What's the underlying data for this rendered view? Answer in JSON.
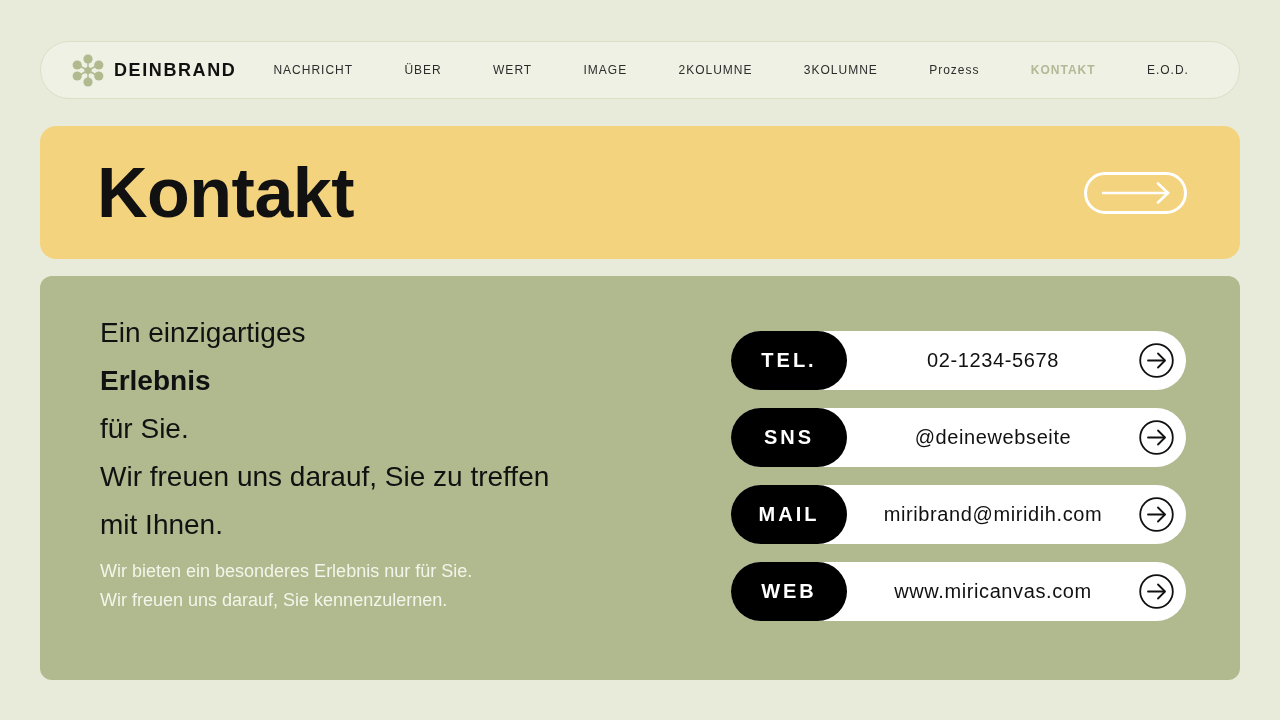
{
  "navbar": {
    "brand": "DEINBRAND",
    "items": [
      {
        "label": "NACHRICHT",
        "selected": false
      },
      {
        "label": "ÜBER",
        "selected": false
      },
      {
        "label": "WERT",
        "selected": false
      },
      {
        "label": "IMAGE",
        "selected": false
      },
      {
        "label": "2KOLUMNE",
        "selected": false
      },
      {
        "label": "3KOLUMNE",
        "selected": false
      },
      {
        "label": "Prozess",
        "selected": false
      },
      {
        "label": "KONTAKT",
        "selected": true
      },
      {
        "label": "E.O.D.",
        "selected": false
      }
    ]
  },
  "banner": {
    "title": "Kontakt"
  },
  "intro": {
    "headline": "Ein einzigartiges\n**Erlebnis**\nfür Sie.\nWir freuen uns darauf, Sie zu treffen\nmit Ihnen.",
    "text": "Wir bieten ein besonderes Erlebnis nur für Sie.\nWir freuen uns darauf, Sie kennenzulernen."
  },
  "contacts": [
    {
      "label": "TEL.",
      "value": "02-1234-5678"
    },
    {
      "label": "SNS",
      "value": "@deinewebseite"
    },
    {
      "label": "MAIL",
      "value": "miribrand@miridih.com"
    },
    {
      "label": "WEB",
      "value": "www.miricanvas.com"
    }
  ]
}
